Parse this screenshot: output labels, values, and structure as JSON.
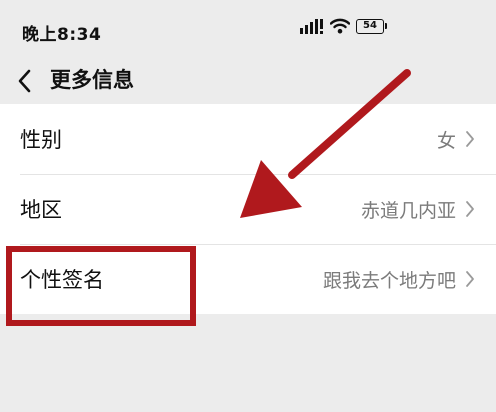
{
  "status_bar": {
    "time": "晚上8:34",
    "battery_level": "54",
    "icons": [
      "signal-icon",
      "wifi-icon",
      "battery-icon"
    ]
  },
  "nav": {
    "back_icon": "chevron-left-icon",
    "title": "更多信息"
  },
  "list": {
    "items": [
      {
        "label": "性别",
        "value": "女"
      },
      {
        "label": "地区",
        "value": "赤道几内亚"
      },
      {
        "label": "个性签名",
        "value": "跟我去个地方吧"
      }
    ]
  },
  "annotation": {
    "highlighted_item": "个性签名",
    "color": "#b0191d"
  },
  "colors": {
    "page_background": "#ececec",
    "list_background": "#ffffff",
    "value_text": "#7b7b7b"
  }
}
